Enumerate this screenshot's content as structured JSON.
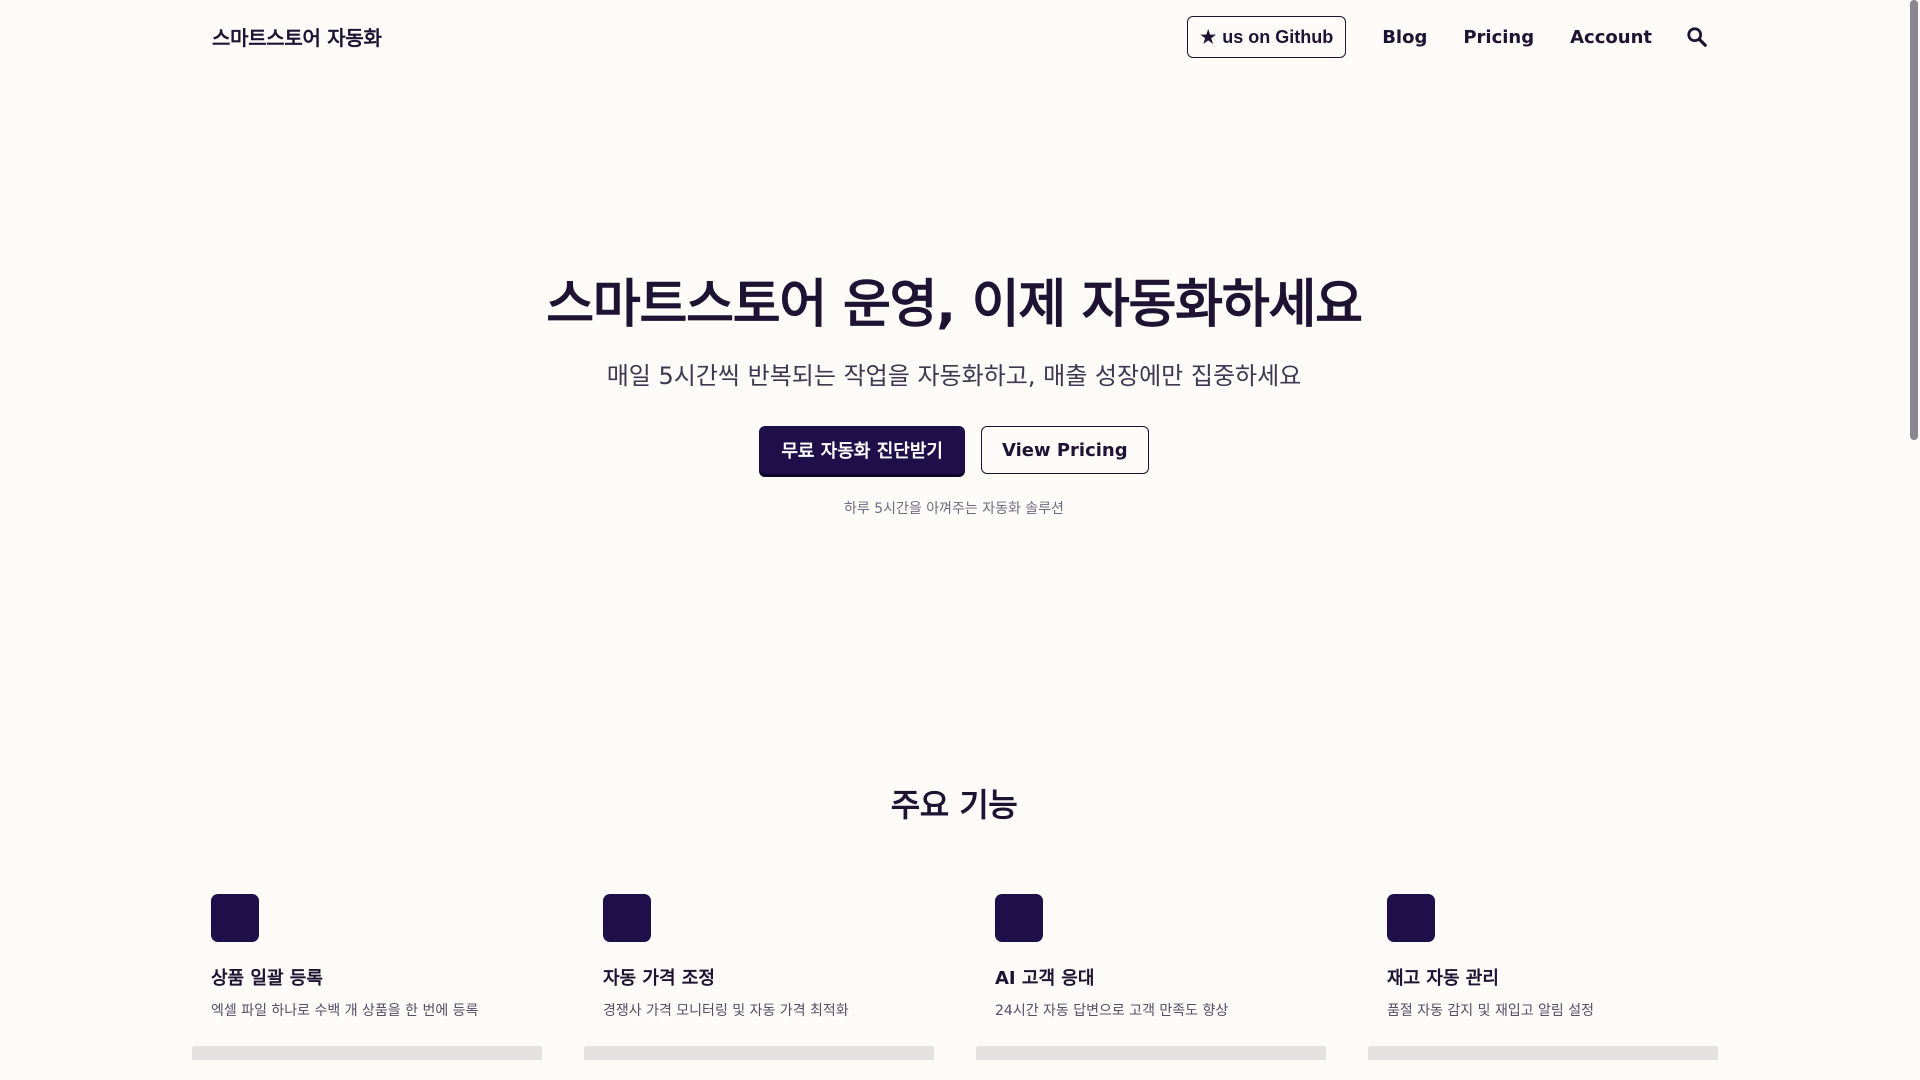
{
  "header": {
    "brand": "스마트스토어 자동화",
    "github_star": "★",
    "github_label": "us on Github",
    "nav": [
      "Blog",
      "Pricing",
      "Account"
    ],
    "search_icon": "search-icon"
  },
  "hero": {
    "title": "스마트스토어 운영, 이제 자동화하세요",
    "subtitle": "매일 5시간씩 반복되는 작업을 자동화하고, 매출 성장에만 집중하세요",
    "primary_cta": "무료 자동화 진단받기",
    "secondary_cta": "View Pricing",
    "note": "하루 5시간을 아껴주는 자동화 솔루션"
  },
  "features": {
    "title": "주요 기능",
    "items": [
      {
        "title": "상품 일괄 등록",
        "desc": "엑셀 파일 하나로 수백 개 상품을 한 번에 등록"
      },
      {
        "title": "자동 가격 조정",
        "desc": "경쟁사 가격 모니터링 및 자동 가격 최적화"
      },
      {
        "title": "AI 고객 응대",
        "desc": "24시간 자동 답변으로 고객 만족도 향상"
      },
      {
        "title": "재고 자동 관리",
        "desc": "품절 자동 감지 및 재입고 알림 설정"
      }
    ]
  },
  "colors": {
    "background": "#fdfbf7",
    "primary": "#1e0f4a",
    "text": "#1e1333"
  }
}
